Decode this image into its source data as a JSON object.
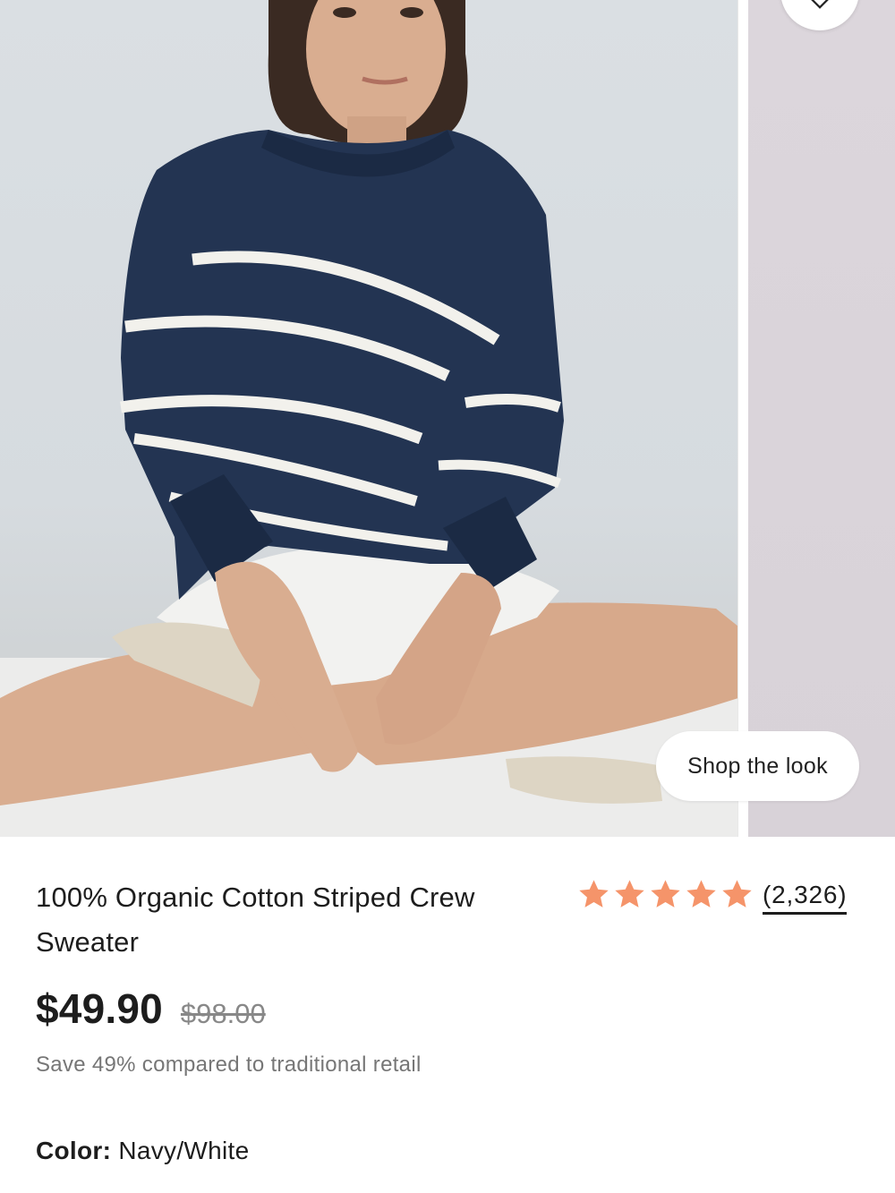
{
  "gallery": {
    "shop_the_look_label": "Shop the look",
    "wishlist_icon": "heart-icon"
  },
  "product": {
    "title": "100% Organic Cotton Striped Crew Sweater",
    "rating": {
      "stars": 5,
      "star_color": "#f5946a",
      "review_count": "(2,326)"
    },
    "price_current": "$49.90",
    "price_original": "$98.00",
    "savings_text": "Save 49% compared to traditional retail",
    "color_label": "Color:",
    "color_value": "Navy/White"
  },
  "colors": {
    "sweater_navy": "#233452",
    "stripe_white": "#f2f1ec",
    "star_orange": "#f5946a"
  }
}
